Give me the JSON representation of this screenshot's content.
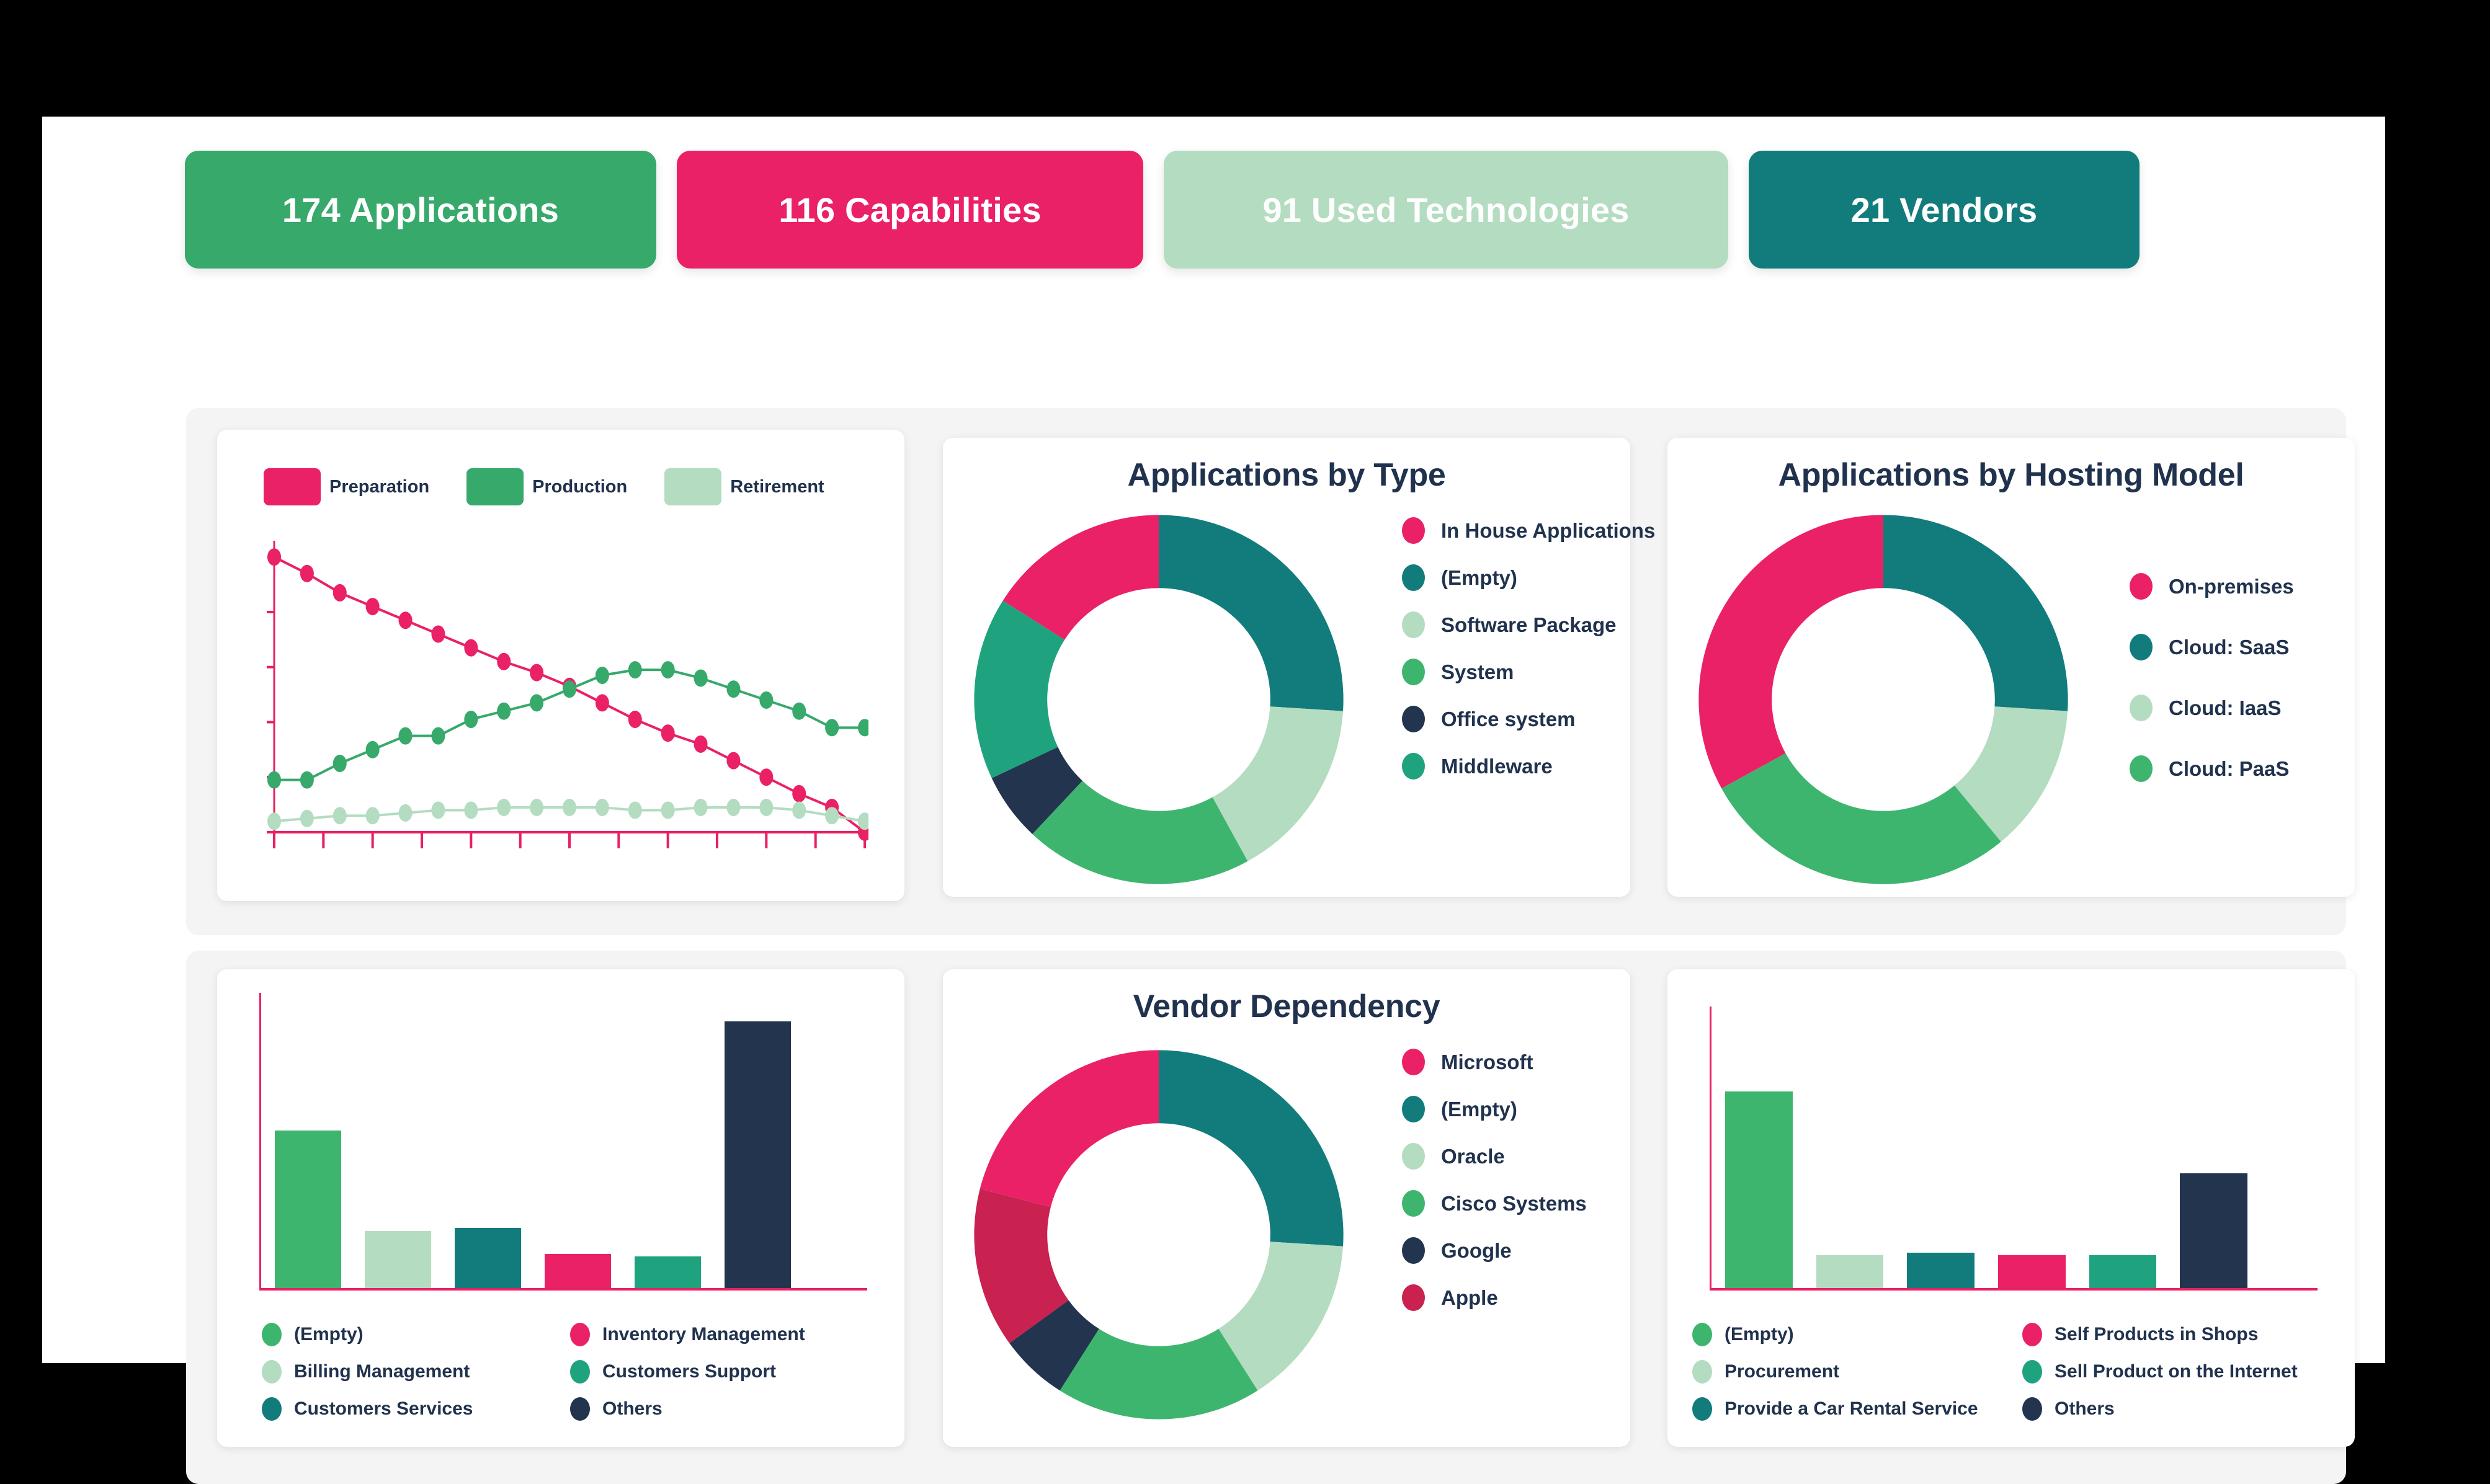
{
  "palette": {
    "pink": "#EA2167",
    "green": "#36A96B",
    "mint": "#B4DCC0",
    "teal": "#127C7C",
    "sea": "#1FA37E",
    "navy": "#23344F",
    "crimson": "#C92150",
    "axis_pink": "#E91F63",
    "title": "#20324D",
    "card_bg": "#FFFFFF",
    "band_bg": "#F4F4F4",
    "page_bg": "#FFFFFF",
    "frame_bg": "#000000"
  },
  "kpis": [
    {
      "label": "174 Applications",
      "color": "#36A96B",
      "text_color": "#FFFFFF"
    },
    {
      "label": "116 Capabilities",
      "color": "#EA2167",
      "text_color": "#FFFFFF"
    },
    {
      "label": "91 Used Technologies",
      "color": "#B4DCC0",
      "text_color": "#FFFFFF"
    },
    {
      "label": "21 Vendors",
      "color": "#127C7C",
      "text_color": "#FFFFFF"
    }
  ],
  "chart_data": [
    {
      "id": "lifecycle",
      "type": "line",
      "title": "",
      "xlabel": "",
      "ylabel": "",
      "grid": false,
      "legend_position": "top-left",
      "ylim": [
        0,
        105
      ],
      "x": [
        0,
        1,
        2,
        3,
        4,
        5,
        6,
        7,
        8,
        9,
        10,
        11,
        12,
        13,
        14,
        15,
        16,
        17,
        18
      ],
      "series": [
        {
          "name": "Preparation",
          "color": "#EA2167",
          "values": [
            100,
            94,
            87,
            82,
            77,
            72,
            67,
            62,
            58,
            53,
            47,
            41,
            36,
            32,
            26,
            20,
            14,
            9,
            0
          ]
        },
        {
          "name": "Production",
          "color": "#36A96B",
          "values": [
            19,
            19,
            25,
            30,
            35,
            35,
            41,
            44,
            47,
            52,
            57,
            59,
            59,
            56,
            52,
            48,
            44,
            38,
            38
          ]
        },
        {
          "name": "Retirement",
          "color": "#B4DCC0",
          "values": [
            4,
            5,
            6,
            6,
            7,
            8,
            8,
            9,
            9,
            9,
            9,
            8,
            8,
            9,
            9,
            9,
            8,
            6,
            4
          ]
        }
      ]
    },
    {
      "id": "applications-by-type",
      "type": "pie",
      "title": "Applications by Type",
      "legend_position": "right",
      "categories": [
        "In House Applications",
        "(Empty)",
        "Software Package",
        "System",
        "Office system",
        "Middleware"
      ],
      "values": [
        16,
        26,
        16,
        20,
        6,
        16
      ],
      "colors": [
        "#EA2167",
        "#127C7C",
        "#B4DCC0",
        "#3EB56F",
        "#23344F",
        "#1FA37E"
      ]
    },
    {
      "id": "applications-by-hosting-model",
      "type": "pie",
      "title": "Applications by Hosting Model",
      "legend_position": "right",
      "categories": [
        "On-premises",
        "Cloud: SaaS",
        "Cloud: IaaS",
        "Cloud: PaaS"
      ],
      "values": [
        33,
        26,
        13,
        28
      ],
      "colors": [
        "#EA2167",
        "#127C7C",
        "#B4DCC0",
        "#3EB56F"
      ]
    },
    {
      "id": "capability-distribution",
      "type": "bar",
      "title": "",
      "xlabel": "",
      "ylabel": "",
      "grid": false,
      "legend_position": "bottom",
      "ylim": [
        0,
        100
      ],
      "categories": [
        "(Empty)",
        "Billing Management",
        "Customers Services",
        "Inventory Management",
        "Customers Support",
        "Others"
      ],
      "values": [
        55,
        20,
        21,
        12,
        11,
        93
      ],
      "colors": [
        "#3EB56F",
        "#B4DCC0",
        "#127C7C",
        "#EA2167",
        "#1FA37E",
        "#23344F"
      ]
    },
    {
      "id": "vendor-dependency",
      "type": "pie",
      "title": "Vendor Dependency",
      "legend_position": "right",
      "categories": [
        "Microsoft",
        "(Empty)",
        "Oracle",
        "Cisco Systems",
        "Google",
        "Apple"
      ],
      "values": [
        21,
        26,
        15,
        18,
        6,
        14
      ],
      "colors": [
        "#EA2167",
        "#127C7C",
        "#B4DCC0",
        "#3EB56F",
        "#23344F",
        "#C92150"
      ]
    },
    {
      "id": "business-capability-distribution",
      "type": "bar",
      "title": "",
      "xlabel": "",
      "ylabel": "",
      "grid": false,
      "legend_position": "bottom",
      "ylim": [
        0,
        100
      ],
      "categories": [
        "(Empty)",
        "Procurement",
        "Provide a Car Rental Service",
        "Self Products in Shops",
        "Sell Product on the Internet",
        "Others"
      ],
      "values": [
        72,
        12,
        13,
        12,
        12,
        42
      ],
      "colors": [
        "#3EB56F",
        "#B4DCC0",
        "#127C7C",
        "#EA2167",
        "#1FA37E",
        "#23344F"
      ]
    }
  ]
}
